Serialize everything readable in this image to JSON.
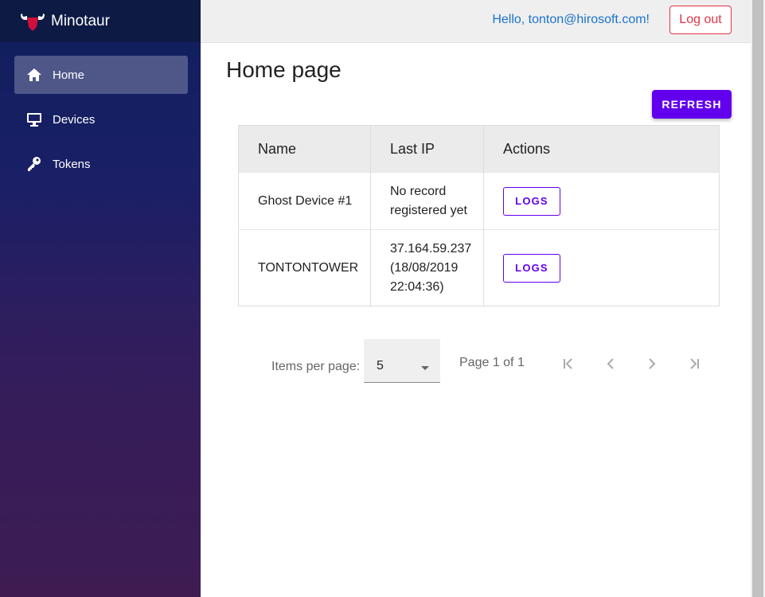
{
  "brand": {
    "name": "Minotaur"
  },
  "sidebar": {
    "items": [
      {
        "label": "Home",
        "icon": "home-icon",
        "active": true
      },
      {
        "label": "Devices",
        "icon": "monitor-icon",
        "active": false
      },
      {
        "label": "Tokens",
        "icon": "key-icon",
        "active": false
      }
    ]
  },
  "header": {
    "greeting": "Hello, tonton@hirosoft.com!",
    "logout_label": "Log out"
  },
  "main": {
    "title": "Home page",
    "refresh_label": "REFRESH"
  },
  "table": {
    "columns": [
      "Name",
      "Last IP",
      "Actions"
    ],
    "rows": [
      {
        "name": "Ghost Device #1",
        "last_ip": [
          "No record",
          "registered yet"
        ],
        "action": "LOGS"
      },
      {
        "name": "TONTONTOWER",
        "last_ip": [
          "37.164.59.237",
          "(18/08/2019",
          "22:04:36)"
        ],
        "action": "LOGS"
      }
    ]
  },
  "pagination": {
    "items_per_page_label": "Items per page:",
    "items_per_page_value": "5",
    "page_label": "Page 1 of 1"
  },
  "colors": {
    "accent": "#6200ee",
    "danger": "#dc3545",
    "link": "#1a73c9"
  }
}
